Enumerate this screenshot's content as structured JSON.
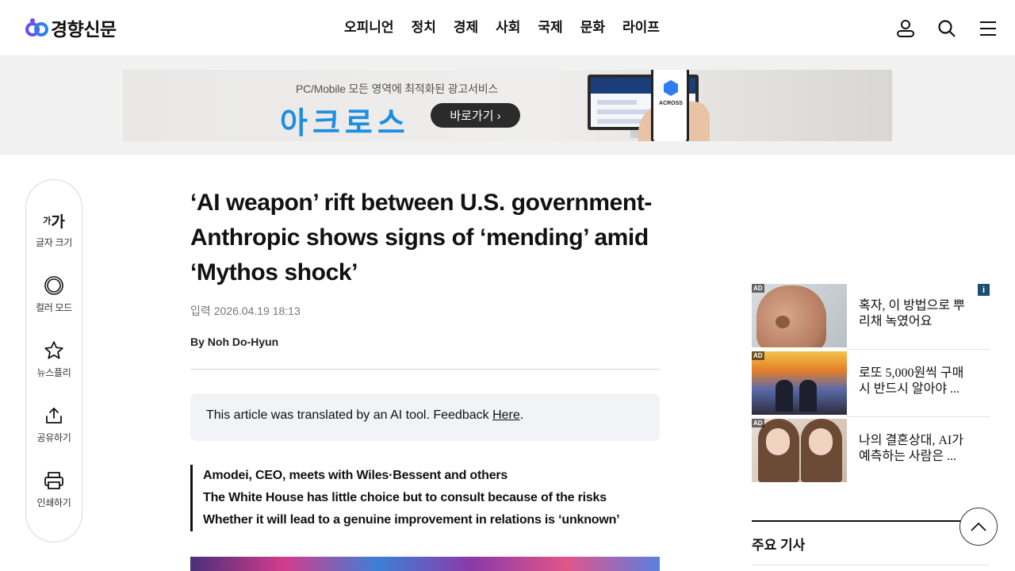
{
  "header": {
    "logo_text": "경향신문",
    "nav": [
      "오피니언",
      "정치",
      "경제",
      "사회",
      "국제",
      "문화",
      "라이프"
    ],
    "icons": [
      "user-icon",
      "search-icon",
      "menu-icon"
    ]
  },
  "banner": {
    "subtitle": "PC/Mobile 모든 영역에 최적화된 광고서비스",
    "title": "아크로스",
    "button": "바로가기 ›",
    "phone_text": "ACROSS"
  },
  "toolbar": {
    "font_size_small": "가",
    "font_size_big": "가",
    "font_size_label": "글자 크기",
    "color_mode_label": "컬러 모드",
    "newsfly_label": "뉴스플리",
    "share_label": "공유하기",
    "print_label": "인쇄하기"
  },
  "article": {
    "headline": "‘AI weapon’ rift between U.S. government-Anthropic shows signs of ‘mending’ amid ‘Mythos shock’",
    "date_label": "입력",
    "date_value": "2026.04.19 18:13",
    "byline": "By Noh Do-Hyun",
    "notice_text": "This article was translated by an AI tool. Feedback ",
    "notice_link": "Here",
    "notice_end": ".",
    "summary": [
      "Amodei, CEO, meets with Wiles·Bessent and others",
      "The White House has little choice but to consult because of the risks",
      "Whether it will lead to a genuine improvement in relations is ‘unknown’"
    ]
  },
  "sidebar": {
    "ad_info": "i",
    "ad_tag": "AD",
    "ads": [
      {
        "line1": "혹자, 이 방법으로 뿌",
        "line2": "리채 녹였어요"
      },
      {
        "line1": "로또 5,000원씩 구매",
        "line2": "시 반드시 알아야 ..."
      },
      {
        "line1": "나의 결혼상대, AI가",
        "line2": "예측하는 사람은 ..."
      }
    ],
    "section_title": "주요 기사"
  },
  "colors": {
    "accent": "#1e8fe0",
    "logo_purple": "#6a4ff0",
    "logo_blue": "#2f7df2"
  }
}
